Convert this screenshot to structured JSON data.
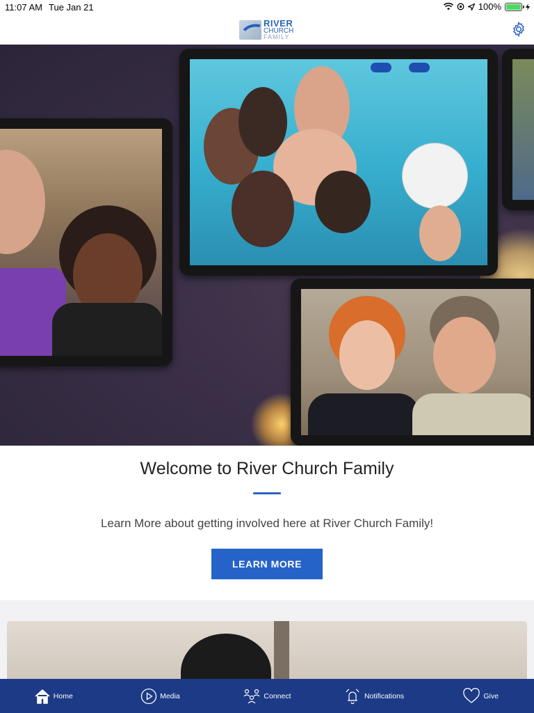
{
  "status_bar": {
    "time": "11:07 AM",
    "date": "Tue Jan 21",
    "battery": "100%"
  },
  "header": {
    "logo_line1": "RIVER",
    "logo_line2": "CHURCH",
    "logo_line3": "FAMILY"
  },
  "welcome": {
    "title": "Welcome to River Church Family",
    "description": "Learn More about getting involved here at River Church Family!",
    "button_label": "LEARN MORE"
  },
  "tabs": [
    {
      "label": "Home",
      "icon": "home-icon"
    },
    {
      "label": "Media",
      "icon": "play-icon"
    },
    {
      "label": "Connect",
      "icon": "people-icon"
    },
    {
      "label": "Notifications",
      "icon": "bell-icon"
    },
    {
      "label": "Give",
      "icon": "heart-icon"
    }
  ],
  "colors": {
    "accent": "#2563c8",
    "tab_bar": "#1c3a86"
  }
}
